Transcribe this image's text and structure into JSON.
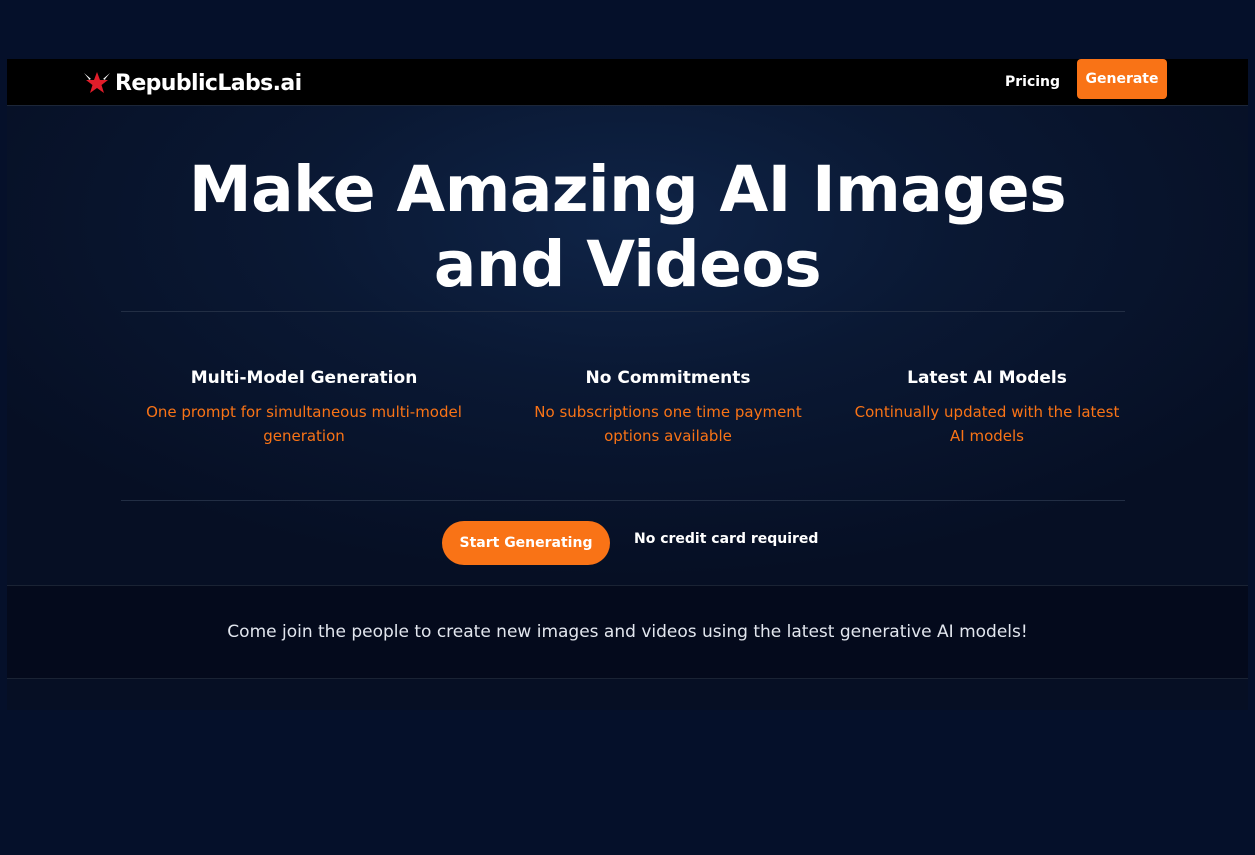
{
  "brand": {
    "name": "RepublicLabs.ai",
    "accent_color": "#f97316",
    "logo_icon": "red-star-wings-icon"
  },
  "nav": {
    "pricing_label": "Pricing",
    "generate_label": "Generate"
  },
  "hero": {
    "title_line1": "Make Amazing AI Images",
    "title_line2": "and Videos"
  },
  "features": [
    {
      "title": "Multi-Model Generation",
      "description": "One prompt for simultaneous multi-model generation"
    },
    {
      "title": "No Commitments",
      "description": "No subscriptions one time payment options available"
    },
    {
      "title": "Latest AI Models",
      "description": "Continually updated with the latest AI models"
    }
  ],
  "cta": {
    "button_label": "Start Generating",
    "note": "No credit card required"
  },
  "join": {
    "text": "Come join the people to create new images and videos using the latest generative AI models!"
  }
}
